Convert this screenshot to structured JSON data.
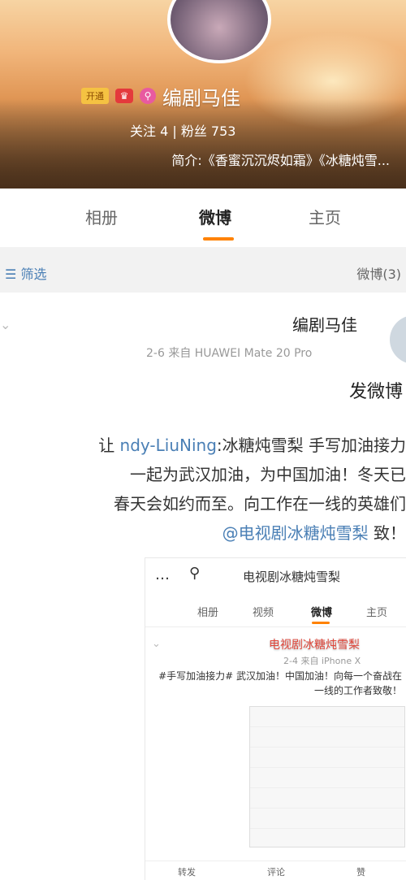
{
  "profile": {
    "vip_badge": "开通",
    "name": "编剧马佳",
    "stats": "关注 4  |  粉丝 753",
    "intro": "简介:《香蜜沉沉烬如霜》《冰糖炖雪..."
  },
  "tabs": {
    "home": "主页",
    "weibo": "微博",
    "album": "相册"
  },
  "filter": {
    "count_label": "微博(3)",
    "filter_label": "筛选"
  },
  "post": {
    "author": "编剧马佳",
    "meta": "2-6  来自 HUAWEI Mate 20 Pro",
    "title": "发微博",
    "body_line1_prefix": "让",
    "body_line1_link": "ndy-LiuNing",
    "body_line1_rest": ":冰糖炖雪梨 手写加油接力",
    "body_line2": "一起为武汉加油，为中国加油！冬天已",
    "body_line3": "春天会如约而至。向工作在一线的英雄们",
    "body_line4_link": "@电视剧冰糖炖雪梨",
    "body_line4_end": "致！"
  },
  "embed": {
    "title": "电视剧冰糖炖雪梨",
    "tabs": {
      "home": "主页",
      "weibo": "微博",
      "video": "视频",
      "album": "相册"
    },
    "author": "电视剧冰糖炖雪梨",
    "meta": "2-4  来自 iPhone X",
    "text": "#手写加油接力# 武汉加油！中国加油！向每一个奋战在一线的工作者致敬！",
    "bottom": {
      "share": "转发",
      "comment": "评论",
      "like": "赞"
    }
  }
}
